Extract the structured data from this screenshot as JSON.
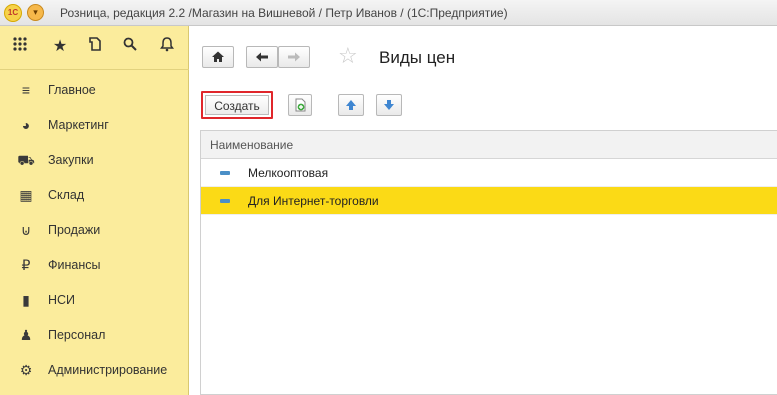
{
  "window": {
    "logo_text": "1С",
    "title": "Розница, редакция 2.2 /Магазин на Вишневой / Петр Иванов /  (1С:Предприятие)"
  },
  "sidebar": {
    "items": [
      {
        "label": "Главное",
        "icon": "menu-lines-icon"
      },
      {
        "label": "Маркетинг",
        "icon": "pie-chart-icon"
      },
      {
        "label": "Закупки",
        "icon": "truck-icon"
      },
      {
        "label": "Склад",
        "icon": "warehouse-icon"
      },
      {
        "label": "Продажи",
        "icon": "basket-icon"
      },
      {
        "label": "Финансы",
        "icon": "ruble-icon"
      },
      {
        "label": "НСИ",
        "icon": "books-icon"
      },
      {
        "label": "Персонал",
        "icon": "person-icon"
      },
      {
        "label": "Администрирование",
        "icon": "gear-icon"
      }
    ]
  },
  "main": {
    "title": "Виды цен",
    "create_label": "Создать",
    "table": {
      "column": "Наименование",
      "rows": [
        {
          "name": "Мелкооптовая",
          "selected": false
        },
        {
          "name": "Для Интернет-торговли",
          "selected": true
        }
      ]
    }
  },
  "colors": {
    "sidebar_bg": "#fbec9c",
    "selected_row": "#fbda16",
    "highlight_border": "#e0262b"
  }
}
